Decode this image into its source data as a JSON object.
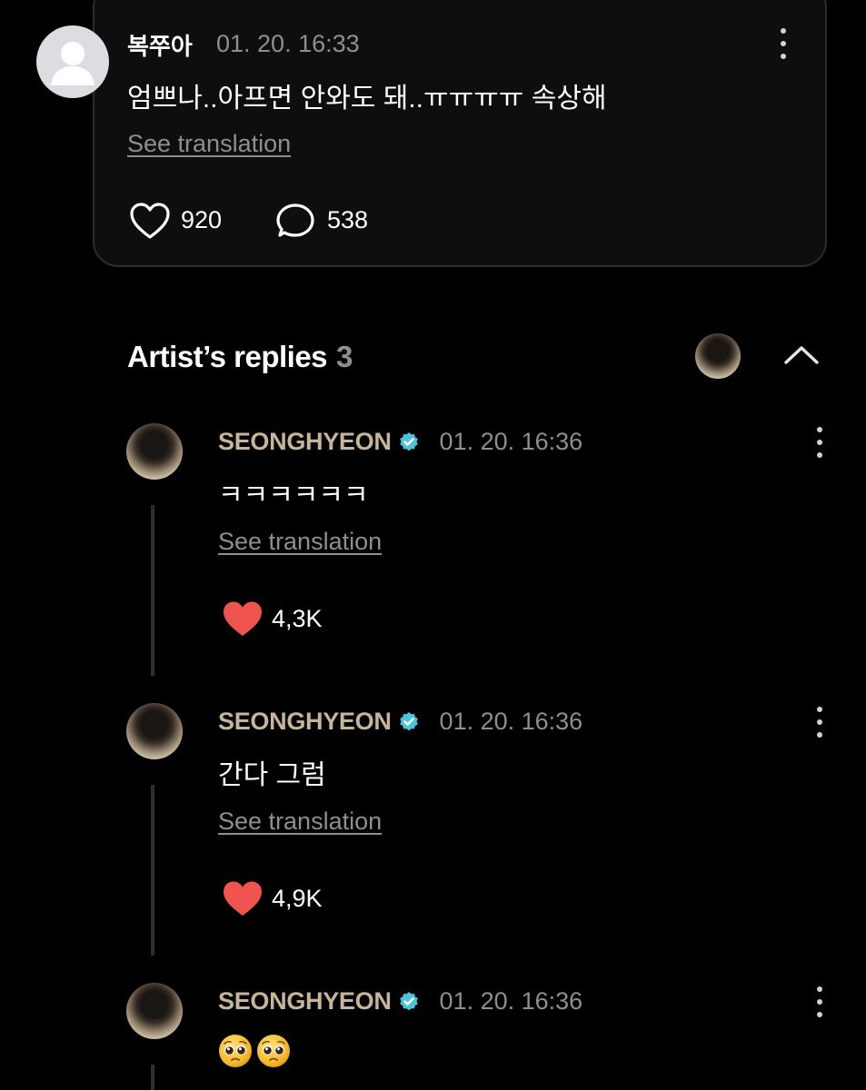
{
  "top_comment": {
    "username": "복쭈아",
    "time": "01. 20. 16:33",
    "text": "엄쁘나..아프면 안와도 돼..ㅠㅠㅠㅠ 속상해",
    "see_translation": "See translation",
    "likes": "920",
    "replies": "538"
  },
  "artist_replies": {
    "title": "Artist’s replies",
    "count": "3",
    "items": [
      {
        "name": "SEONGHYEON",
        "time": "01. 20. 16:36",
        "text": "ㅋㅋㅋㅋㅋㅋ",
        "see_translation": "See translation",
        "likes": "4,3K"
      },
      {
        "name": "SEONGHYEON",
        "time": "01. 20. 16:36",
        "text": "간다 그럼",
        "see_translation": "See translation",
        "likes": "4,9K"
      },
      {
        "name": "SEONGHYEON",
        "time": "01. 20. 16:36",
        "emoji": "pleading-face-emoji"
      }
    ]
  },
  "colors": {
    "background": "#000000",
    "card": "#0e0e0f",
    "artist_name": "#c8b49b",
    "heart_filled": "#f0544f",
    "verified": "#4fc3d9",
    "muted": "#8e8e93"
  }
}
